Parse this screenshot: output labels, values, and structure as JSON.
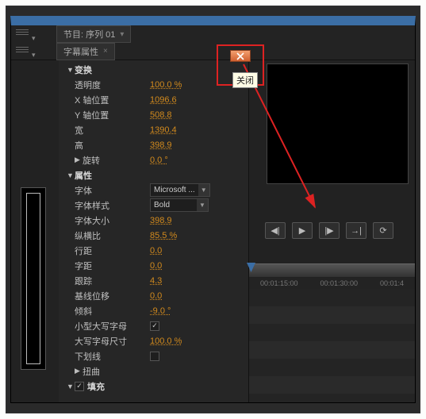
{
  "tabs": {
    "sequence": "节目: 序列 01",
    "titleprops": "字幕属性"
  },
  "tooltip": "关闭",
  "groups": {
    "transform": "变换",
    "rotation": "旋转",
    "attributes": "属性",
    "distort": "扭曲",
    "fill": "填充"
  },
  "props": {
    "opacity": {
      "label": "透明度",
      "value": "100.0 %"
    },
    "x": {
      "label": "X 轴位置",
      "value": "1096.6"
    },
    "y": {
      "label": "Y 轴位置",
      "value": "508.8"
    },
    "width": {
      "label": "宽",
      "value": "1390.4"
    },
    "height": {
      "label": "高",
      "value": "398.9"
    },
    "rotation_value": "0.0 °",
    "font": {
      "label": "字体"
    },
    "fontstyle": {
      "label": "字体样式"
    },
    "fontsize": {
      "label": "字体大小",
      "value": "398.9"
    },
    "aspect": {
      "label": "纵横比",
      "value": "85.5 %"
    },
    "leading": {
      "label": "行距",
      "value": "0.0"
    },
    "kerning": {
      "label": "字距",
      "value": "0.0"
    },
    "tracking": {
      "label": "跟踪",
      "value": "4.3"
    },
    "baseline": {
      "label": "基线位移",
      "value": "0.0"
    },
    "slant": {
      "label": "倾斜",
      "value": "-9.0 °"
    },
    "smallcaps": {
      "label": "小型大写字母"
    },
    "smallcapsize": {
      "label": "大写字母尺寸",
      "value": "100.0 %"
    },
    "underline": {
      "label": "下划线"
    }
  },
  "combos": {
    "font": "Microsoft ...",
    "fontstyle": "Bold"
  },
  "checks": {
    "smallcaps": "✓",
    "underline": "",
    "fill": "✓"
  },
  "timeline": {
    "t1": "00:01:15:00",
    "t2": "00:01:30:00",
    "t3": "00:01:4"
  }
}
